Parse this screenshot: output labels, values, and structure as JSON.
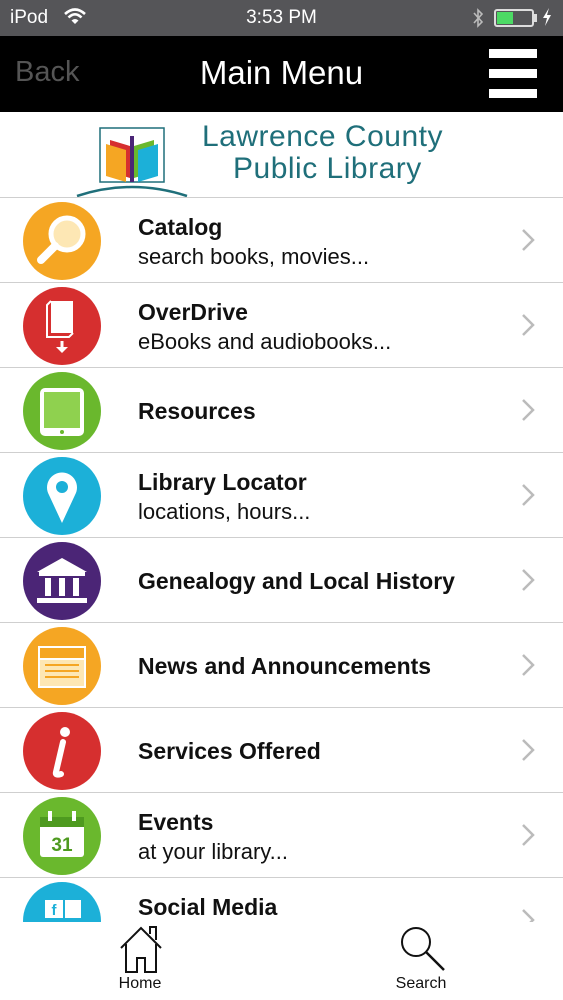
{
  "status_bar": {
    "carrier": "iPod",
    "time": "3:53 PM"
  },
  "nav": {
    "back_label": "Back",
    "title": "Main Menu"
  },
  "logo": {
    "line1": "Lawrence County",
    "line2": "Public Library"
  },
  "menu": [
    {
      "title": "Catalog",
      "subtitle": "search books, movies...",
      "icon": "magnifier-icon",
      "color": "#f5a623"
    },
    {
      "title": "OverDrive",
      "subtitle": "eBooks and audiobooks...",
      "icon": "ebook-download-icon",
      "color": "#d62f2f"
    },
    {
      "title": "Resources",
      "subtitle": "",
      "icon": "tablet-icon",
      "color": "#6ab82d"
    },
    {
      "title": "Library Locator",
      "subtitle": "locations, hours...",
      "icon": "map-pin-icon",
      "color": "#1cb0d8"
    },
    {
      "title": "Genealogy and Local History",
      "subtitle": "",
      "icon": "museum-icon",
      "color": "#4b2576"
    },
    {
      "title": "News and Announcements",
      "subtitle": "",
      "icon": "newspaper-icon",
      "color": "#f5a623"
    },
    {
      "title": "Services Offered",
      "subtitle": "",
      "icon": "info-icon",
      "color": "#d62f2f"
    },
    {
      "title": "Events",
      "subtitle": "at your library...",
      "icon": "calendar-icon",
      "color": "#6ab82d",
      "icon_text": "31"
    },
    {
      "title": "Social Media",
      "subtitle": "",
      "icon": "social-icon",
      "color": "#1cb0d8"
    }
  ],
  "tabbar": {
    "home_label": "Home",
    "search_label": "Search"
  }
}
